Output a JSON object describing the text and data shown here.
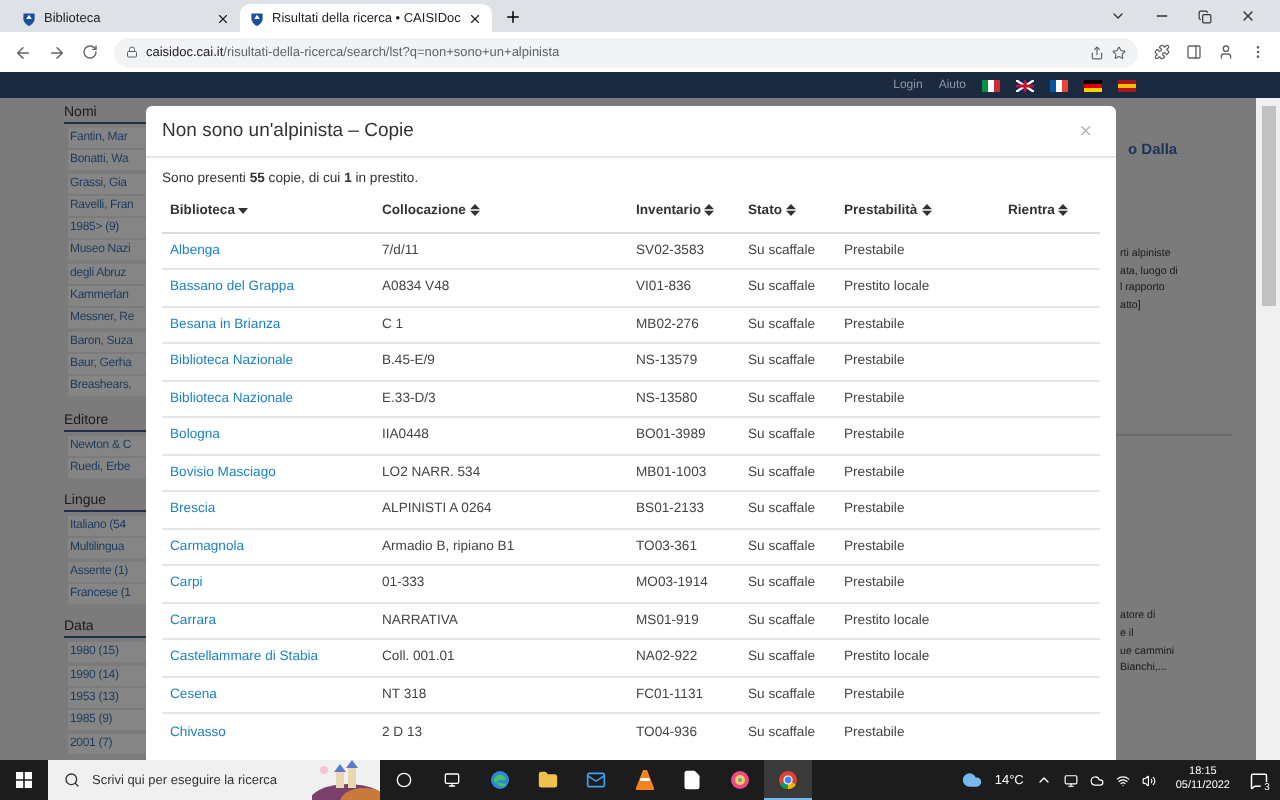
{
  "browser": {
    "tabs": [
      {
        "title": "Biblioteca",
        "selected": false
      },
      {
        "title": "Risultati della ricerca • CAISIDoc",
        "selected": true
      }
    ],
    "url_domain": "caisidoc.cai.it",
    "url_path": "/risultati-della-ricerca/search/lst?q=non+sono+un+alpinista"
  },
  "header": {
    "links": [
      "Login",
      "Aiuto"
    ]
  },
  "sidebar": {
    "sections": [
      {
        "heading": "Nomi",
        "items": [
          "Fantin, Mar",
          "Bonatti, Wa",
          "Grassi, Gia",
          "Ravelli, Fran",
          "1985> (9)",
          "Museo Nazi",
          "degli Abruz",
          "Kammerlan",
          "Messner, Re",
          "Baron, Suza",
          "Baur, Gerha",
          "Breashears,"
        ]
      },
      {
        "heading": "Editore",
        "items": [
          "Newton & C",
          "Ruedi, Erbe"
        ]
      },
      {
        "heading": "Lingue",
        "items": [
          "Italiano (54",
          "Multilingua",
          "Assente (1)",
          "Francese (1"
        ]
      },
      {
        "heading": "Data",
        "items": [
          "1980 (15)",
          "1990 (14)",
          "1953 (13)",
          "1985 (9)",
          "2001 (7)"
        ]
      }
    ]
  },
  "right_column": {
    "link": "o Dalla",
    "blocks": [
      [
        "rti alpiniste",
        "ata, luogo di",
        "l rapporto",
        "atto]"
      ],
      [
        "atore di",
        "e il",
        "ue cammini",
        "Bianchi,..."
      ]
    ]
  },
  "modal": {
    "title": "Non sono un'alpinista – Copie",
    "close": "×",
    "summary": "Sono presenti **55** copie, di cui **1** in prestito.",
    "columns": [
      {
        "label": "Biblioteca",
        "sorted": true
      },
      {
        "label": "Collocazione",
        "sorted": false
      },
      {
        "label": "Inventario",
        "sorted": false
      },
      {
        "label": "Stato",
        "sorted": false
      },
      {
        "label": "Prestabilità",
        "sorted": false
      },
      {
        "label": "Rientra",
        "sorted": false
      }
    ],
    "rows": [
      [
        "Albenga",
        "7/d/11",
        "SV02-3583",
        "Su scaffale",
        "Prestabile"
      ],
      [
        "Bassano del Grappa",
        "A0834 V48",
        "VI01-836",
        "Su scaffale",
        "Prestito locale"
      ],
      [
        "Besana in Brianza",
        "C 1",
        "MB02-276",
        "Su scaffale",
        "Prestabile"
      ],
      [
        "Biblioteca Nazionale",
        "B.45-E/9",
        "NS-13579",
        "Su scaffale",
        "Prestabile"
      ],
      [
        "Biblioteca Nazionale",
        "E.33-D/3",
        "NS-13580",
        "Su scaffale",
        "Prestabile"
      ],
      [
        "Bologna",
        "IIA0448",
        "BO01-3989",
        "Su scaffale",
        "Prestabile"
      ],
      [
        "Bovisio Masciago",
        "LO2 NARR. 534",
        "MB01-1003",
        "Su scaffale",
        "Prestabile"
      ],
      [
        "Brescia",
        "ALPINISTI A 0264",
        "BS01-2133",
        "Su scaffale",
        "Prestabile"
      ],
      [
        "Carmagnola",
        "Armadio B, ripiano B1",
        "TO03-361",
        "Su scaffale",
        "Prestabile"
      ],
      [
        "Carpi",
        "01-333",
        "MO03-1914",
        "Su scaffale",
        "Prestabile"
      ],
      [
        "Carrara",
        "NARRATIVA",
        "MS01-919",
        "Su scaffale",
        "Prestito locale"
      ],
      [
        "Castellammare di Stabia",
        "Coll. 001.01",
        "NA02-922",
        "Su scaffale",
        "Prestito locale"
      ],
      [
        "Cesena",
        "NT 318",
        "FC01-1131",
        "Su scaffale",
        "Prestabile"
      ],
      [
        "Chivasso",
        "2 D 13",
        "TO04-936",
        "Su scaffale",
        "Prestabile"
      ]
    ]
  },
  "taskbar": {
    "search_placeholder": "Scrivi qui per eseguire la ricerca",
    "temperature": "14°C",
    "time": "18:15",
    "date": "05/11/2022",
    "notifications": "3"
  }
}
